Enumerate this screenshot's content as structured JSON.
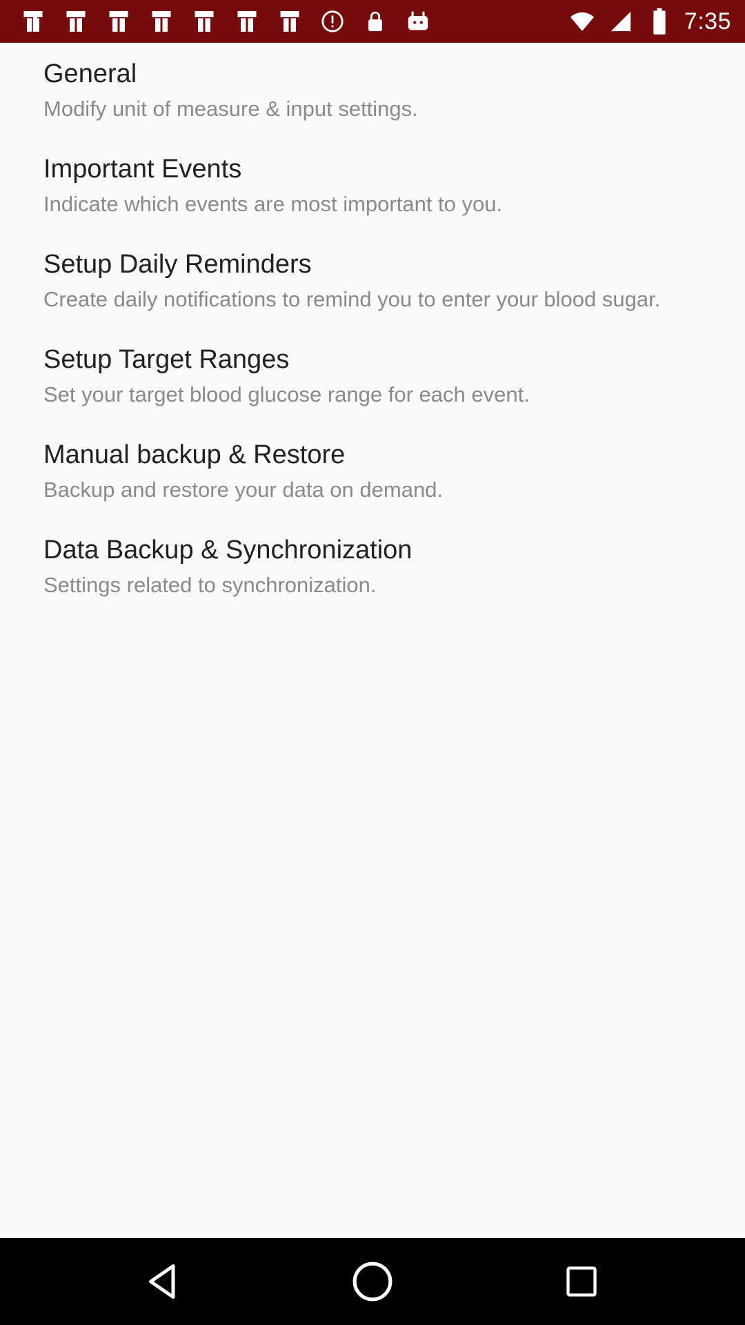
{
  "status_bar": {
    "time": "7:35",
    "background_color": "#770a0a",
    "left_icons": [
      "notification-icon",
      "notification-icon",
      "notification-icon",
      "notification-icon",
      "notification-icon",
      "notification-icon",
      "notification-icon",
      "alert-icon",
      "lock-icon",
      "android-icon"
    ]
  },
  "settings": {
    "items": [
      {
        "title": "General",
        "summary": "Modify unit of measure & input settings."
      },
      {
        "title": "Important Events",
        "summary": "Indicate which events are most important to you."
      },
      {
        "title": "Setup Daily Reminders",
        "summary": "Create daily notifications to remind you to enter your blood sugar."
      },
      {
        "title": "Setup Target Ranges",
        "summary": "Set your target blood glucose range for each event."
      },
      {
        "title": "Manual backup & Restore",
        "summary": "Backup and restore your data on demand."
      },
      {
        "title": "Data Backup & Synchronization",
        "summary": "Settings related to synchronization."
      }
    ]
  },
  "nav_bar": {
    "buttons": [
      "back-icon",
      "home-icon",
      "recents-icon"
    ]
  }
}
